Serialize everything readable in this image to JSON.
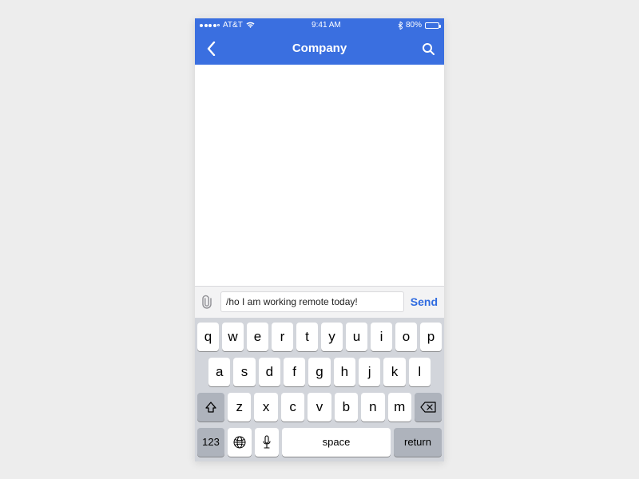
{
  "statusbar": {
    "carrier": "AT&T",
    "time": "9:41 AM",
    "battery_pct": "80%"
  },
  "navbar": {
    "title": "Company"
  },
  "composer": {
    "value": "/ho I am working remote today!",
    "send_label": "Send"
  },
  "keyboard": {
    "row1": [
      "q",
      "w",
      "e",
      "r",
      "t",
      "y",
      "u",
      "i",
      "o",
      "p"
    ],
    "row2": [
      "a",
      "s",
      "d",
      "f",
      "g",
      "h",
      "j",
      "k",
      "l"
    ],
    "row3": [
      "z",
      "x",
      "c",
      "v",
      "b",
      "n",
      "m"
    ],
    "mode_label": "123",
    "space_label": "space",
    "return_label": "return"
  }
}
